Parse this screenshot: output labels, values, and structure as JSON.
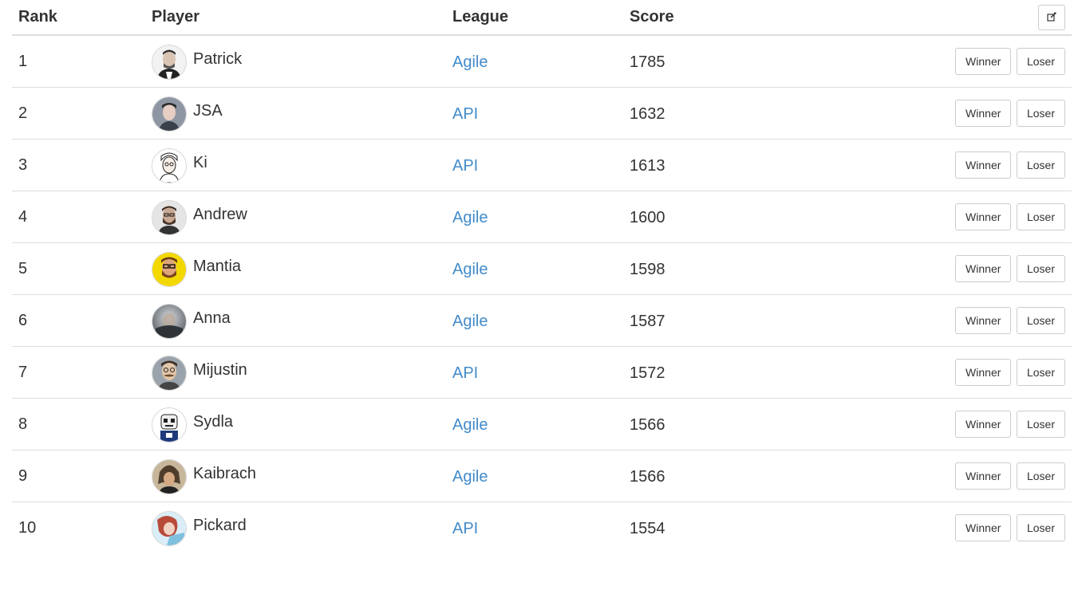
{
  "header": {
    "rank": "Rank",
    "player": "Player",
    "league": "League",
    "score": "Score",
    "edit_icon": "edit-icon"
  },
  "actions": {
    "winner_label": "Winner",
    "loser_label": "Loser"
  },
  "colors": {
    "link": "#428bca",
    "text": "#333333",
    "border": "#dddddd"
  },
  "rows": [
    {
      "rank": "1",
      "player": "Patrick",
      "league": "Agile",
      "score": "1785",
      "avatar": "patrick-avatar"
    },
    {
      "rank": "2",
      "player": "JSA",
      "league": "API",
      "score": "1632",
      "avatar": "jsa-avatar"
    },
    {
      "rank": "3",
      "player": "Ki",
      "league": "API",
      "score": "1613",
      "avatar": "ki-avatar"
    },
    {
      "rank": "4",
      "player": "Andrew",
      "league": "Agile",
      "score": "1600",
      "avatar": "andrew-avatar"
    },
    {
      "rank": "5",
      "player": "Mantia",
      "league": "Agile",
      "score": "1598",
      "avatar": "mantia-avatar"
    },
    {
      "rank": "6",
      "player": "Anna",
      "league": "Agile",
      "score": "1587",
      "avatar": "anna-avatar"
    },
    {
      "rank": "7",
      "player": "Mijustin",
      "league": "API",
      "score": "1572",
      "avatar": "mijustin-avatar"
    },
    {
      "rank": "8",
      "player": "Sydla",
      "league": "Agile",
      "score": "1566",
      "avatar": "sydla-avatar"
    },
    {
      "rank": "9",
      "player": "Kaibrach",
      "league": "Agile",
      "score": "1566",
      "avatar": "kaibrach-avatar"
    },
    {
      "rank": "10",
      "player": "Pickard",
      "league": "API",
      "score": "1554",
      "avatar": "pickard-avatar"
    }
  ]
}
